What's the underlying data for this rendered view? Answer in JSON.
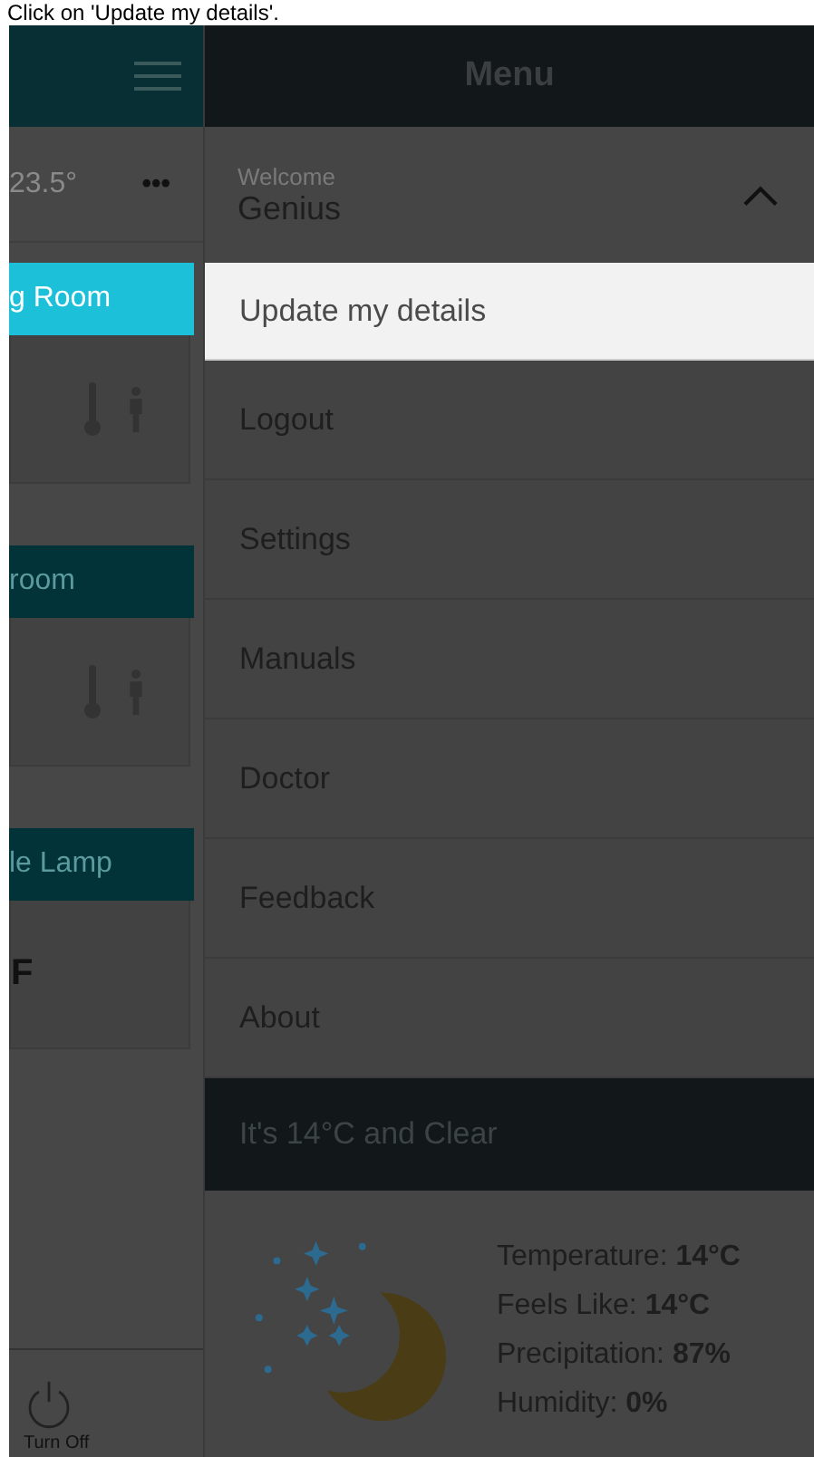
{
  "caption": "Click on 'Update my details'.",
  "background_app": {
    "temperature": "23.5°",
    "more": "•••",
    "rooms": [
      {
        "name": "g Room",
        "selected": true,
        "kind": "icons"
      },
      {
        "name": "room",
        "selected": false,
        "kind": "icons"
      },
      {
        "name": "le Lamp",
        "selected": false,
        "kind": "text",
        "value": "F"
      }
    ],
    "turn_off": "Turn Off"
  },
  "menu": {
    "title": "Menu",
    "welcome": "Welcome",
    "user": "Genius",
    "expanded": true,
    "items": [
      {
        "label": "Update my details",
        "selected": true
      },
      {
        "label": "Logout",
        "selected": false
      },
      {
        "label": "Settings",
        "selected": false
      },
      {
        "label": "Manuals",
        "selected": false
      },
      {
        "label": "Doctor",
        "selected": false
      },
      {
        "label": "Feedback",
        "selected": false
      },
      {
        "label": "About",
        "selected": false
      }
    ]
  },
  "weather": {
    "summary": "It's 14°C and Clear",
    "details": [
      "Temperature: **14°C**",
      "Feels Like: **14°C**",
      "Precipitation: **87%**",
      "Humidity: **0%**"
    ]
  }
}
